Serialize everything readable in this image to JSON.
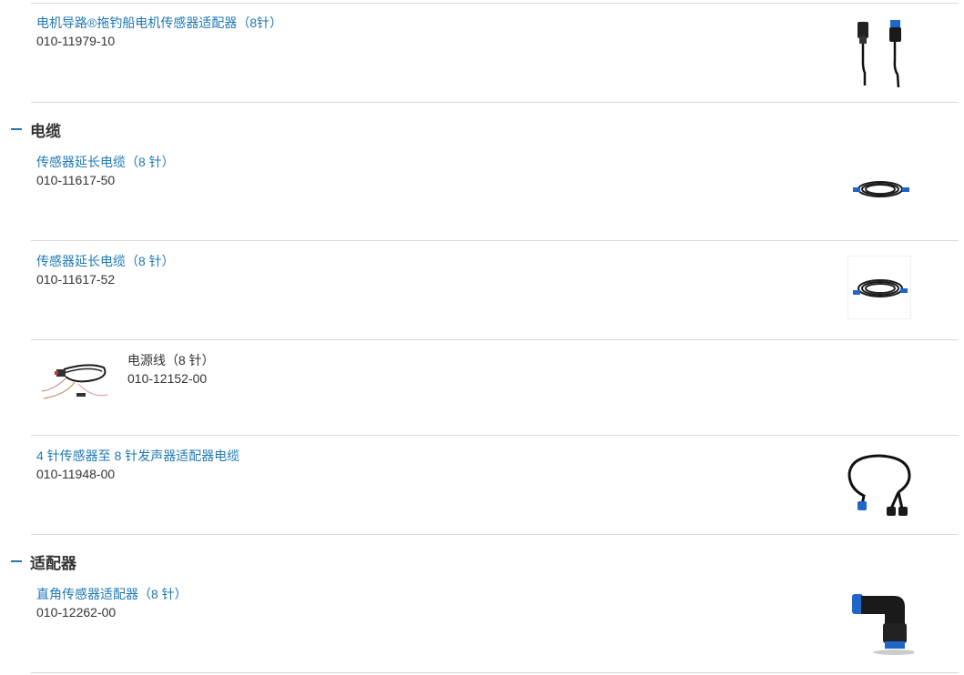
{
  "sections": [
    {
      "title": "电缆",
      "toggle_symbol": "minus-icon"
    },
    {
      "title": "适配器",
      "toggle_symbol": "minus-icon"
    }
  ],
  "items": [
    {
      "name": "电机导路®拖钓船电机传感器适配器（8针）",
      "part_number": "010-11979-10",
      "image": "adapter-cable-image"
    },
    {
      "name": "传感器延长电缆（8 针）",
      "part_number": "010-11617-50",
      "image": "coiled-cable-image"
    },
    {
      "name": "传感器延长电缆（8 针）",
      "part_number": "010-11617-52",
      "image": "coiled-cable-image"
    },
    {
      "name": "电源线（8 针）",
      "part_number": "010-12152-00",
      "image": "power-cable-image"
    },
    {
      "name": "4 针传感器至 8 针发声器适配器电缆",
      "part_number": "010-11948-00",
      "image": "y-cable-image"
    },
    {
      "name": "直角传感器适配器（8 针）",
      "part_number": "010-12262-00",
      "image": "right-angle-adapter-image"
    }
  ],
  "colors": {
    "link": "#1f78b4",
    "text": "#333333",
    "divider": "#d9d9d9",
    "accent_blue": "#1e66c8"
  }
}
